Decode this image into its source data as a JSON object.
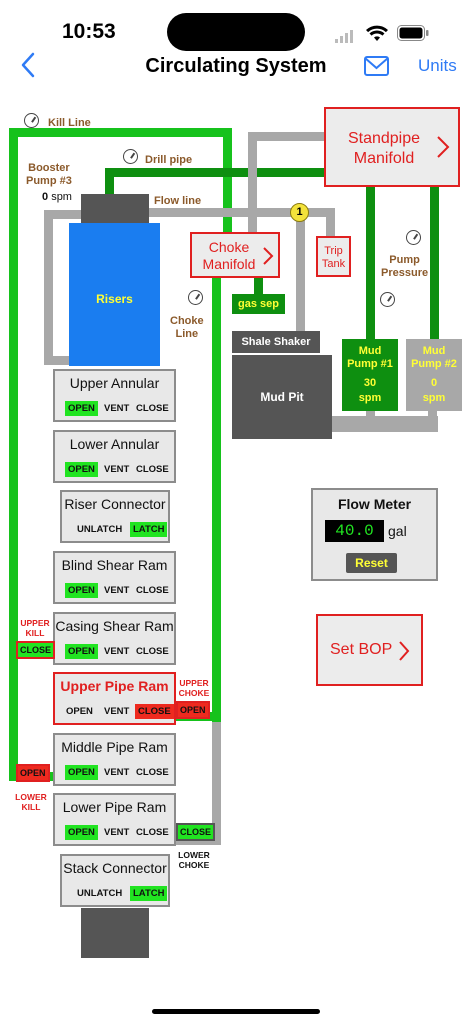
{
  "status": {
    "time": "10:53"
  },
  "nav": {
    "title": "Circulating System",
    "units": "Units"
  },
  "labels": {
    "kill_line": "Kill Line",
    "booster_title": "Booster\nPump #3",
    "booster_value": "0",
    "booster_unit": "spm",
    "drill_pipe": "Drill pipe",
    "flow_line": "Flow line",
    "choke_line": "Choke\nLine",
    "pump_pressure": "Pump\nPressure",
    "risers": "Risers",
    "gas_sep": "gas sep",
    "shale_shaker": "Shale Shaker",
    "mud_pit": "Mud Pit",
    "valve_number": "1"
  },
  "standpipe": {
    "label": "Standpipe\nManifold"
  },
  "choke_manifold": {
    "label": "Choke\nManifold"
  },
  "trip_tank": {
    "label": "Trip\nTank"
  },
  "pumps": [
    {
      "title": "Mud\nPump #1",
      "value": "30",
      "unit": "spm"
    },
    {
      "title": "Mud\nPump #2",
      "value": "0",
      "unit": "spm"
    }
  ],
  "flow_meter": {
    "title": "Flow Meter",
    "value": "40.0",
    "unit": "gal",
    "reset": "Reset"
  },
  "set_bop": {
    "label": "Set BOP"
  },
  "bop": [
    {
      "name": "Upper Annular",
      "buttons": [
        "OPEN",
        "VENT",
        "CLOSE"
      ]
    },
    {
      "name": "Lower Annular",
      "buttons": [
        "OPEN",
        "VENT",
        "CLOSE"
      ]
    },
    {
      "name": "Riser Connector",
      "buttons": [
        "UNLATCH",
        "LATCH"
      ]
    },
    {
      "name": "Blind Shear Ram",
      "buttons": [
        "OPEN",
        "VENT",
        "CLOSE"
      ]
    },
    {
      "name": "Casing Shear Ram",
      "buttons": [
        "OPEN",
        "VENT",
        "CLOSE"
      ]
    },
    {
      "name": "Upper Pipe Ram",
      "buttons": [
        "OPEN",
        "VENT",
        "CLOSE"
      ]
    },
    {
      "name": "Middle Pipe Ram",
      "buttons": [
        "OPEN",
        "VENT",
        "CLOSE"
      ]
    },
    {
      "name": "Lower Pipe Ram",
      "buttons": [
        "OPEN",
        "VENT",
        "CLOSE"
      ]
    },
    {
      "name": "Stack Connector",
      "buttons": [
        "UNLATCH",
        "LATCH"
      ]
    }
  ],
  "side_valves": {
    "upper_kill": {
      "label": "UPPER\nKILL",
      "state": "CLOSE"
    },
    "lower_kill": {
      "label": "LOWER\nKILL",
      "state": "OPEN"
    },
    "upper_choke": {
      "label": "UPPER\nCHOKE",
      "state": "OPEN"
    },
    "lower_choke": {
      "label": "LOWER\nCHOKE",
      "state": "CLOSE"
    }
  },
  "colors": {
    "active_green": "#21e421",
    "closed_red": "#ee2a1f",
    "riser_blue": "#1a7df0",
    "accent_blue": "#2f7bf5"
  },
  "icons": [
    "back-chevron-icon",
    "mail-icon",
    "gauge-icon",
    "chevron-right-icon"
  ]
}
